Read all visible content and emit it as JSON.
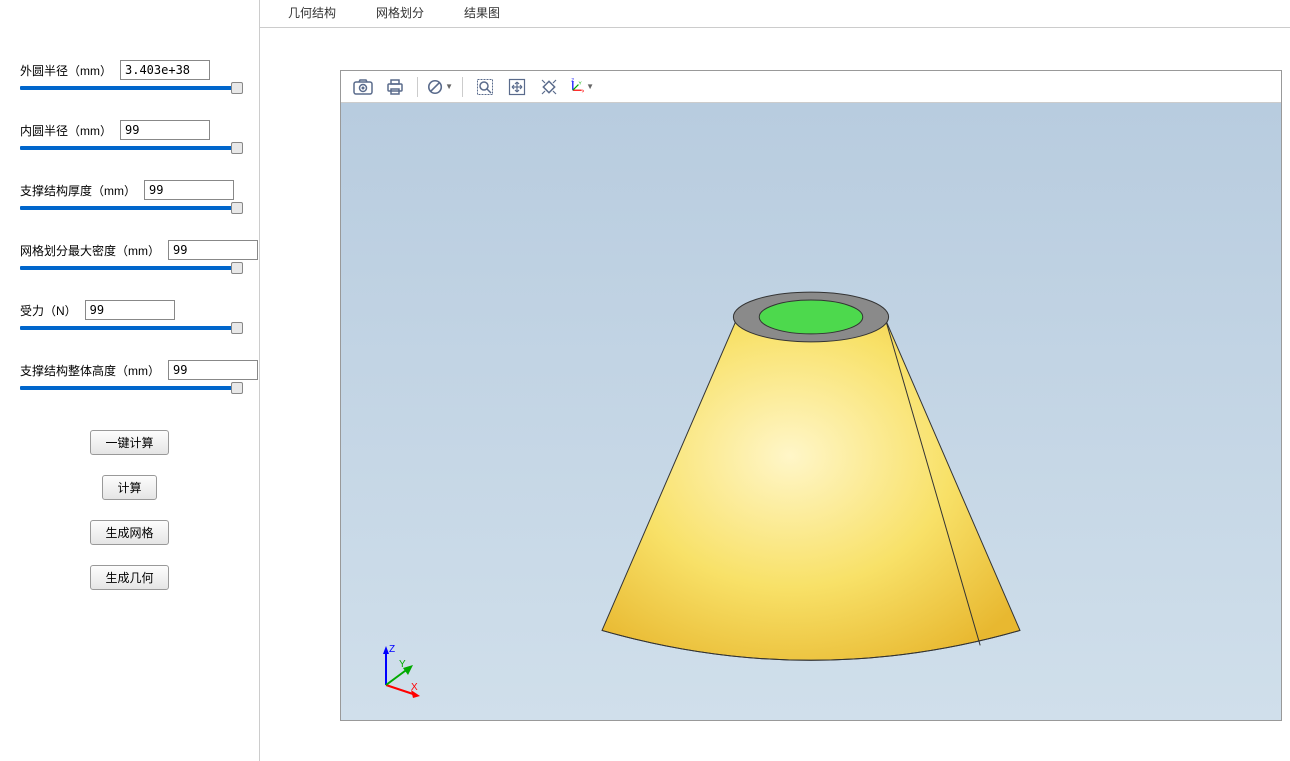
{
  "sidebar": {
    "params": [
      {
        "label": "外圆半径（mm）",
        "value": "3.403e+38"
      },
      {
        "label": "内圆半径（mm）",
        "value": "99"
      },
      {
        "label": "支撑结构厚度（mm）",
        "value": "99"
      },
      {
        "label": "网格划分最大密度（mm）",
        "value": "99"
      },
      {
        "label": "受力（N）",
        "value": "99"
      },
      {
        "label": "支撑结构整体高度（mm）",
        "value": "99"
      }
    ],
    "buttons": {
      "one_click_calc": "一键计算",
      "calc": "计算",
      "gen_mesh": "生成网格",
      "gen_geom": "生成几何"
    }
  },
  "tabs": {
    "geometry": "几何结构",
    "mesh": "网格划分",
    "result": "结果图"
  },
  "toolbar_icons": {
    "camera": "camera",
    "print": "print",
    "forbid": "forbid",
    "zoom_window": "zoom-window",
    "fit": "fit",
    "zoom_extents": "zoom-extents",
    "axes": "axes"
  },
  "triad": {
    "x": "X",
    "y": "Y",
    "z": "Z"
  }
}
